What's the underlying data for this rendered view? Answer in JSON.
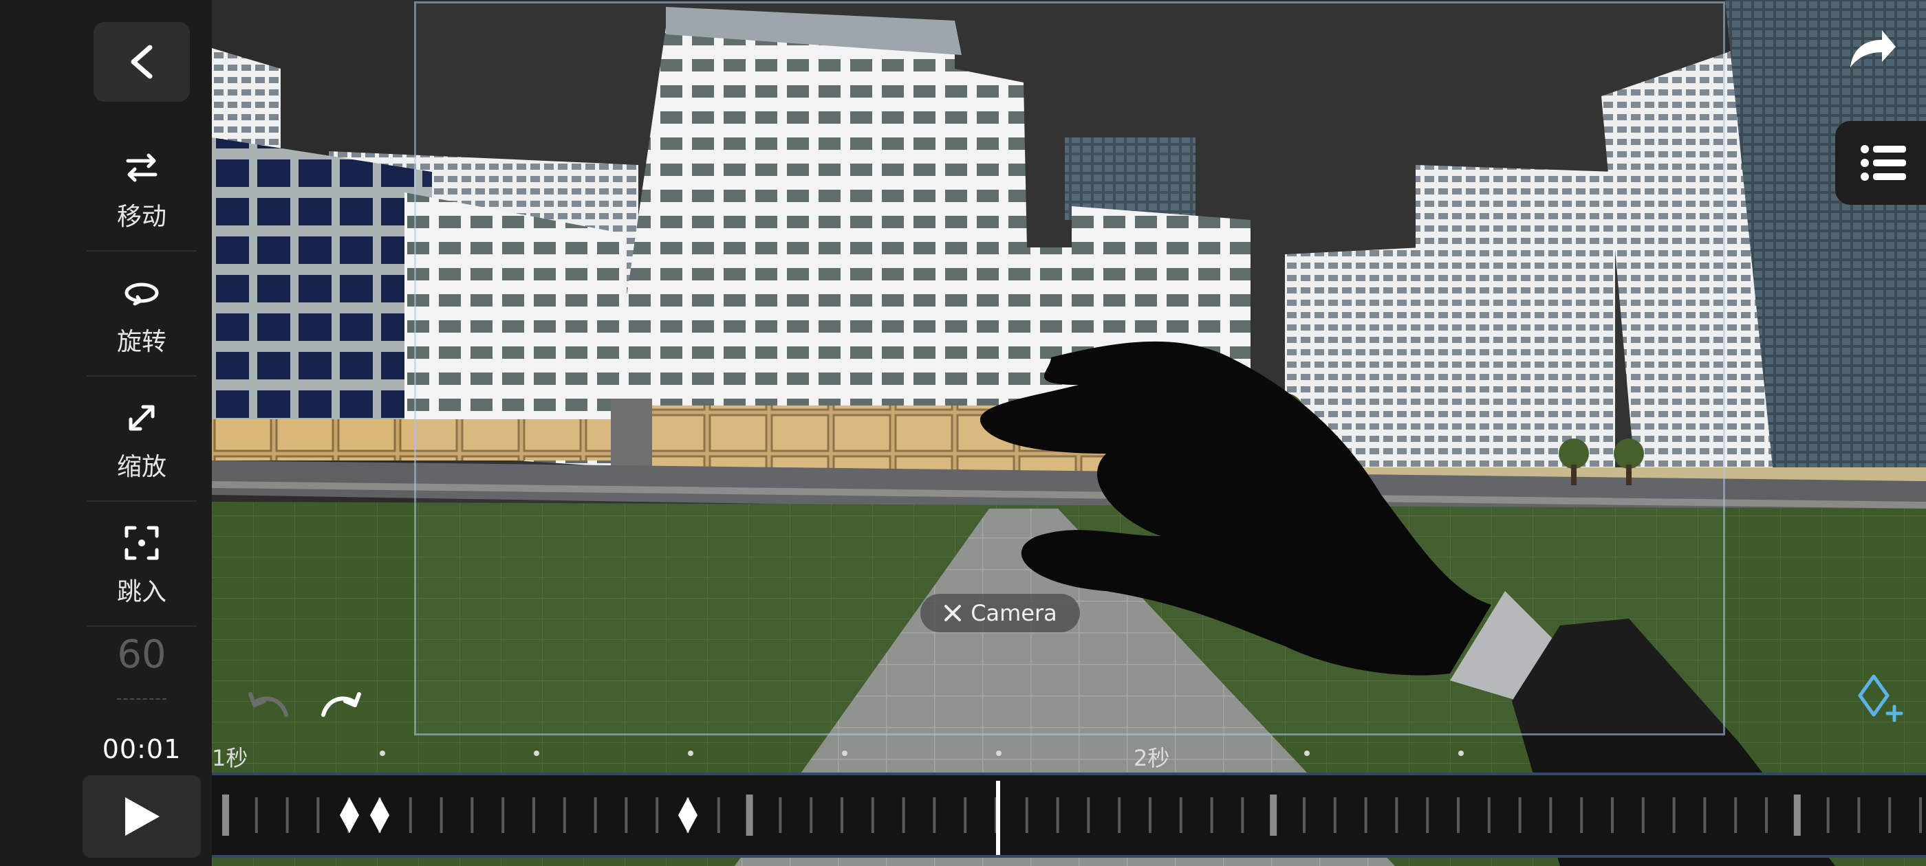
{
  "sidebar": {
    "tools": [
      {
        "label": "移动",
        "icon": "move-arrows-icon"
      },
      {
        "label": "旋转",
        "icon": "rotate-icon"
      },
      {
        "label": "缩放",
        "icon": "scale-icon"
      },
      {
        "label": "跳入",
        "icon": "jump-in-icon"
      }
    ],
    "fps": "60",
    "time": "00:01"
  },
  "viewport": {
    "selection_chip": "Camera"
  },
  "timeline": {
    "labels": [
      "1秒",
      "2秒"
    ],
    "playhead_time": "00:01",
    "keyframes_count": 3
  },
  "colors": {
    "background": "#1c1c1c",
    "track_border": "#2f4a6a",
    "accent": "#5ab4e6"
  }
}
